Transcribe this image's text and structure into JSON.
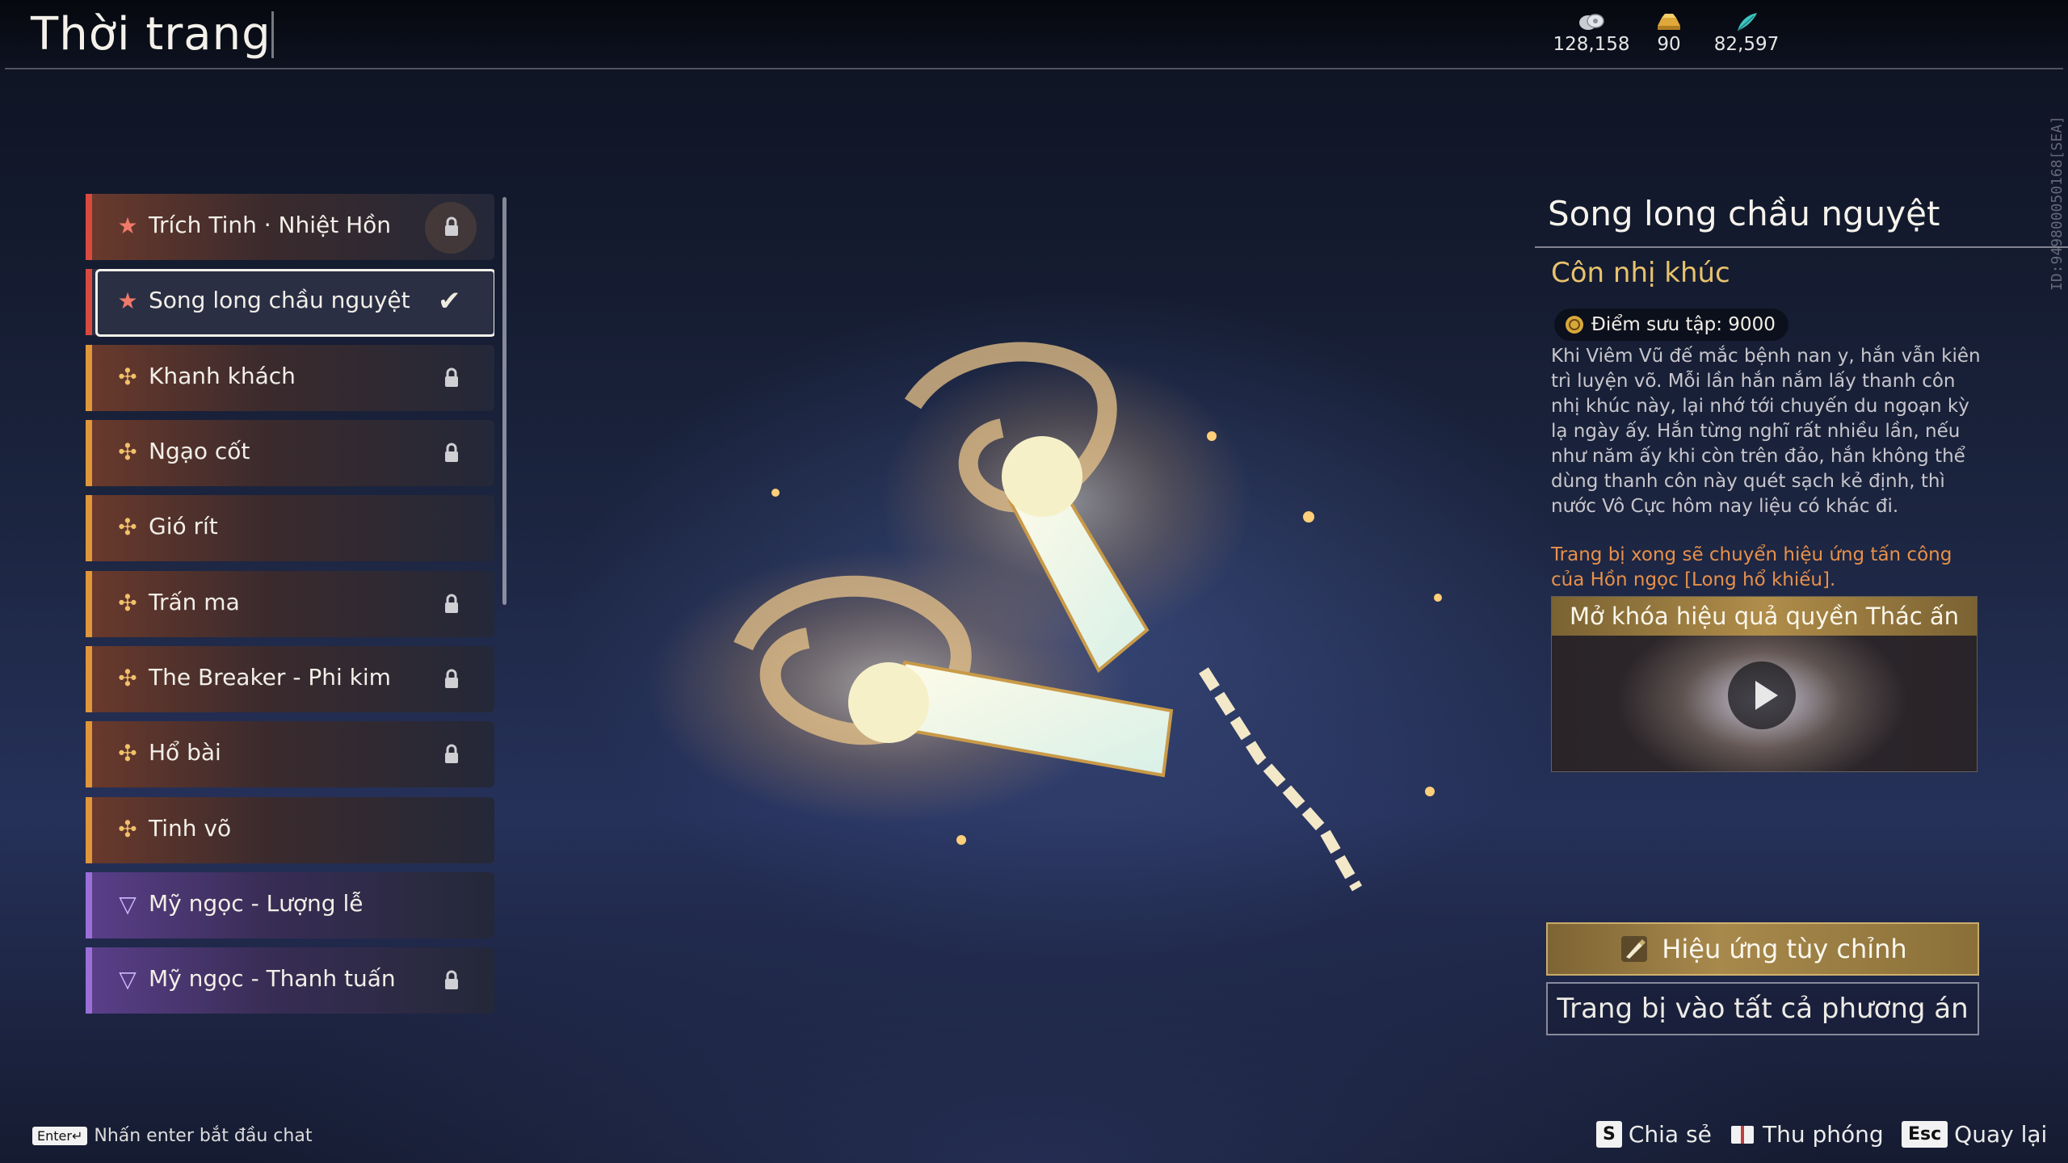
{
  "header": {
    "title": "Thời trang",
    "currencies": [
      {
        "icon": "silver-coin-icon",
        "value": "128,158"
      },
      {
        "icon": "gold-ingot-icon",
        "value": "90"
      },
      {
        "icon": "jade-feather-icon",
        "value": "82,597"
      }
    ]
  },
  "server_id": "ID:9498000501​68[SEA]",
  "list": {
    "items": [
      {
        "label": "Trích Tinh · Nhiệt Hồn",
        "rarity_color": "#d94a3e",
        "mark": "★",
        "locked": true,
        "selected": false
      },
      {
        "label": "Song long chầu nguyệt",
        "rarity_color": "#d94a3e",
        "mark": "★",
        "locked": false,
        "selected": true
      },
      {
        "label": "Khanh khách",
        "rarity_color": "#e0963a",
        "mark": "✣",
        "locked": true,
        "selected": false
      },
      {
        "label": "Ngạo cốt",
        "rarity_color": "#e0963a",
        "mark": "✣",
        "locked": true,
        "selected": false
      },
      {
        "label": "Gió rít",
        "rarity_color": "#e0963a",
        "mark": "✣",
        "locked": false,
        "selected": false
      },
      {
        "label": "Trấn ma",
        "rarity_color": "#e0963a",
        "mark": "✣",
        "locked": true,
        "selected": false
      },
      {
        "label": "The Breaker - Phi kim",
        "rarity_color": "#e0963a",
        "mark": "✣",
        "locked": true,
        "selected": false
      },
      {
        "label": "Hổ bài",
        "rarity_color": "#e0963a",
        "mark": "✣",
        "locked": true,
        "selected": false
      },
      {
        "label": "Tinh võ",
        "rarity_color": "#e0963a",
        "mark": "✣",
        "locked": false,
        "selected": false
      },
      {
        "label": "Mỹ ngọc - Lượng lễ",
        "rarity_color": "#9a6fd8",
        "mark": "▽",
        "locked": false,
        "selected": false
      },
      {
        "label": "Mỹ ngọc - Thanh tuấn",
        "rarity_color": "#9a6fd8",
        "mark": "▽",
        "locked": true,
        "selected": false
      }
    ]
  },
  "detail": {
    "name": "Song long chầu nguyệt",
    "type": "Côn nhị khúc",
    "collection_score": "Điểm sưu tập: 9000",
    "description": "Khi Viêm Vũ đế mắc bệnh nan y, hắn vẫn kiên trì luyện võ. Mỗi lần hắn nắm lấy thanh côn nhị khúc này, lại nhớ tới chuyến du ngoạn kỳ lạ ngày ấy. Hắn từng nghĩ rất nhiều lần, nếu như năm ấy khi còn trên đảo, hắn không thể dùng thanh côn này quét sạch kẻ định, thì nước Vô Cực hôm nay liệu có khác đi.",
    "effect_note": "Trang bị xong sẽ chuyển hiệu ứng tấn công của Hồn ngọc [Long hổ khiếu].",
    "unlock_title": "Mở khóa hiệu quả quyền Thác ấn",
    "buttons": {
      "custom_effect": "Hiệu ứng tùy chỉnh",
      "equip_all": "Trang bị vào tất cả phương án"
    }
  },
  "footer": {
    "chat_key": "Enter↵",
    "chat_hint": "Nhấn enter bắt đầu chat",
    "share_key": "S",
    "share_label": "Chia sẻ",
    "zoom_label": "Thu phóng",
    "back_key": "Esc",
    "back_label": "Quay lại"
  },
  "colors": {
    "accent_gold": "#e8c26c",
    "effect_orange": "#e8904a"
  }
}
